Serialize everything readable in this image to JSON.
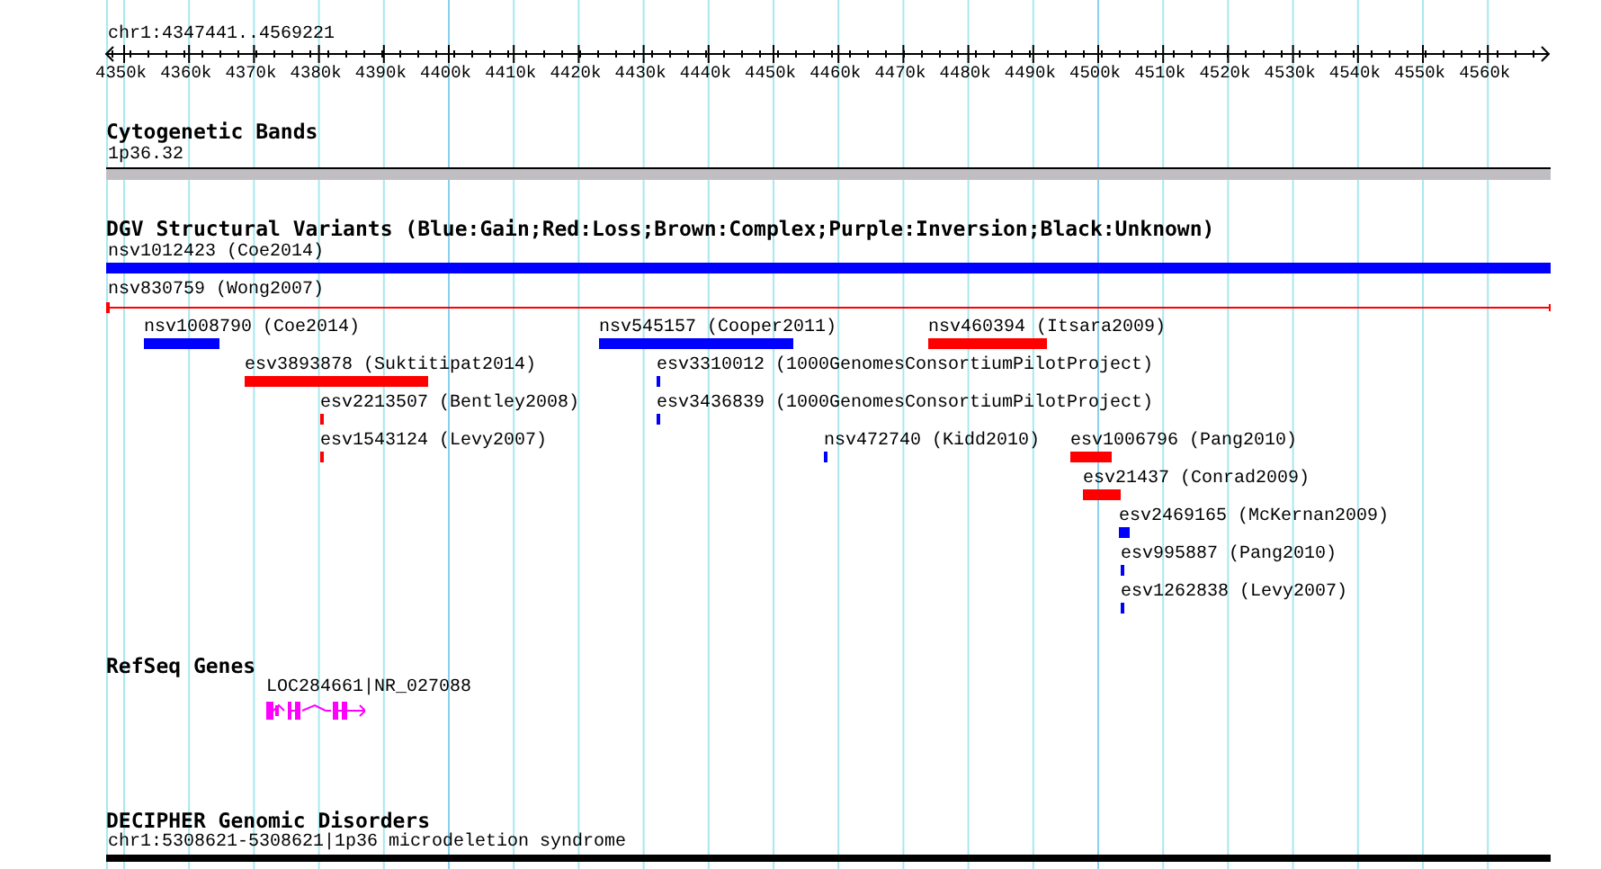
{
  "ruler": {
    "title": "chr1:4347441..4569221",
    "ticks": [
      "4350k",
      "4360k",
      "4370k",
      "4380k",
      "4390k",
      "4400k",
      "4410k",
      "4420k",
      "4430k",
      "4440k",
      "4450k",
      "4460k",
      "4470k",
      "4480k",
      "4490k",
      "4500k",
      "4510k",
      "4520k",
      "4530k",
      "4540k",
      "4550k",
      "4560k"
    ]
  },
  "cytogenetic_bands": {
    "title": "Cytogenetic Bands",
    "band": "1p36.32"
  },
  "dgv": {
    "title": "DGV Structural Variants (Blue:Gain;Red:Loss;Brown:Complex;Purple:Inversion;Black:Unknown)",
    "features": [
      {
        "label": "nsv1012423 (Coe2014)",
        "color": "#0000ff",
        "kind": "bar"
      },
      {
        "label": "nsv830759 (Wong2007)",
        "color": "#ff0000",
        "kind": "line"
      },
      {
        "label": "nsv1008790 (Coe2014)",
        "color": "#0000ff",
        "kind": "bar"
      },
      {
        "label": "nsv545157 (Cooper2011)",
        "color": "#0000ff",
        "kind": "bar"
      },
      {
        "label": "nsv460394 (Itsara2009)",
        "color": "#ff0000",
        "kind": "bar"
      },
      {
        "label": "esv3893878 (Suktitipat2014)",
        "color": "#ff0000",
        "kind": "bar"
      },
      {
        "label": "esv3310012 (1000GenomesConsortiumPilotProject)",
        "color": "#0000ff",
        "kind": "bar"
      },
      {
        "label": "esv2213507 (Bentley2008)",
        "color": "#ff0000",
        "kind": "bar"
      },
      {
        "label": "esv3436839 (1000GenomesConsortiumPilotProject)",
        "color": "#0000ff",
        "kind": "bar"
      },
      {
        "label": "esv1543124 (Levy2007)",
        "color": "#ff0000",
        "kind": "bar"
      },
      {
        "label": "nsv472740 (Kidd2010)",
        "color": "#0000ff",
        "kind": "bar"
      },
      {
        "label": "esv1006796 (Pang2010)",
        "color": "#ff0000",
        "kind": "bar"
      },
      {
        "label": "esv21437 (Conrad2009)",
        "color": "#ff0000",
        "kind": "bar"
      },
      {
        "label": "esv2469165 (McKernan2009)",
        "color": "#0000ff",
        "kind": "bar"
      },
      {
        "label": "esv995887 (Pang2010)",
        "color": "#0000ff",
        "kind": "bar"
      },
      {
        "label": "esv1262838 (Levy2007)",
        "color": "#0000ff",
        "kind": "bar"
      }
    ]
  },
  "refseq_genes": {
    "title": "RefSeq Genes",
    "genes": [
      {
        "label": "LOC284661|NR_027088"
      }
    ]
  },
  "decipher": {
    "title": "DECIPHER Genomic Disorders",
    "features": [
      {
        "label": "chr1:5308621-5308621|1p36 microdeletion syndrome"
      }
    ]
  }
}
